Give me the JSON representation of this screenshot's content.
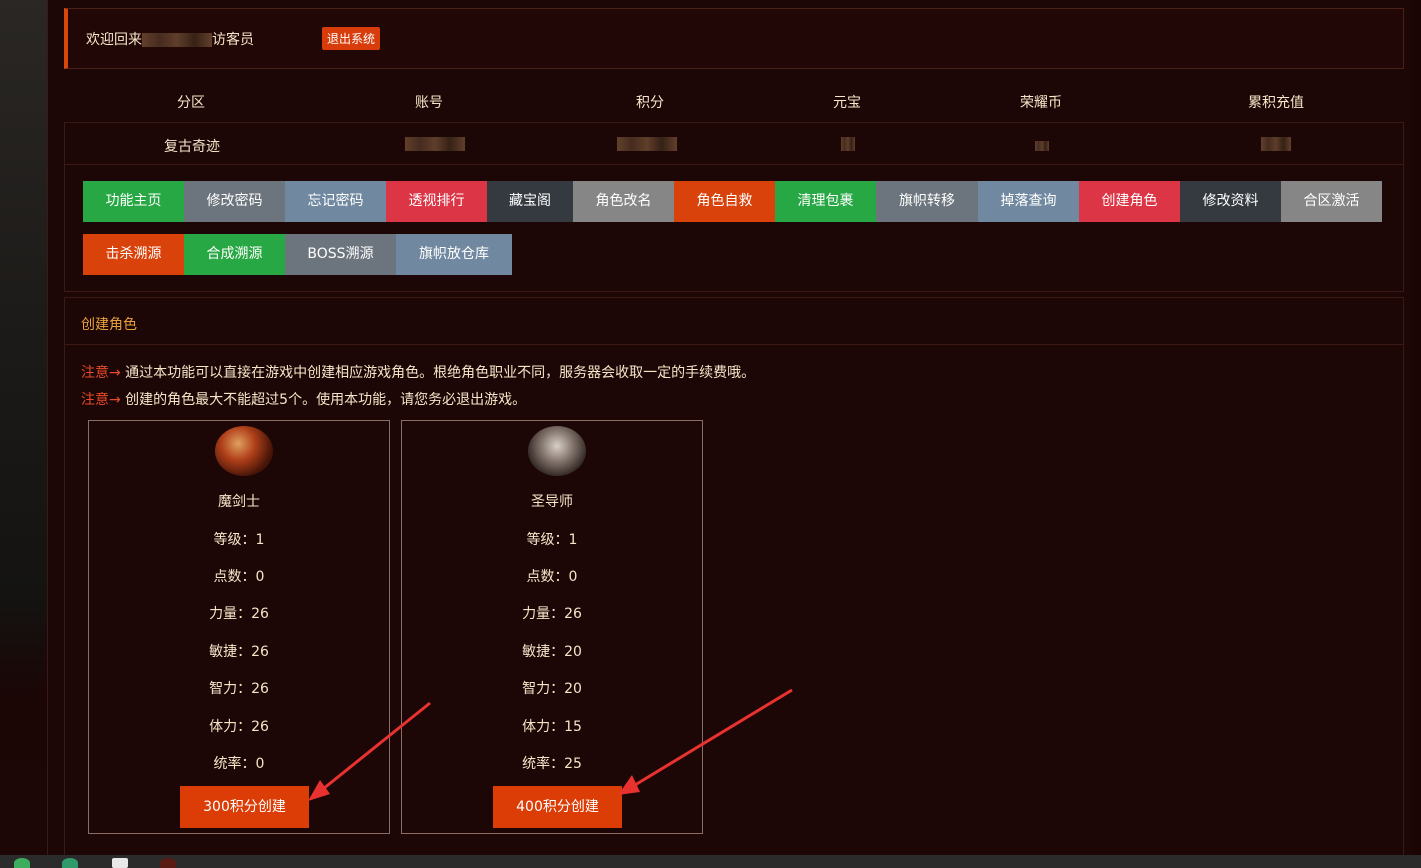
{
  "welcome": {
    "text_prefix": "欢迎回来",
    "text_suffix": "访客员",
    "logout_label": "退出系统"
  },
  "account": {
    "headers": [
      "分区",
      "账号",
      "积分",
      "元宝",
      "荣耀币",
      "累积充值"
    ],
    "zone": "复古奇迹"
  },
  "nav": {
    "row1": [
      {
        "label": "功能主页",
        "color": "#27a844"
      },
      {
        "label": "修改密码",
        "color": "#6c757d"
      },
      {
        "label": "忘记密码",
        "color": "#7089a0"
      },
      {
        "label": "透视排行",
        "color": "#dc3545"
      },
      {
        "label": "藏宝阁",
        "color": "#343a40"
      },
      {
        "label": "角色改名",
        "color": "#868686"
      },
      {
        "label": "角色自救",
        "color": "#d9420a"
      },
      {
        "label": "清理包裹",
        "color": "#27a844"
      },
      {
        "label": "旗帜转移",
        "color": "#6c757d"
      },
      {
        "label": "掉落查询",
        "color": "#7089a0"
      },
      {
        "label": "创建角色",
        "color": "#dc3545"
      },
      {
        "label": "修改资料",
        "color": "#343a40"
      },
      {
        "label": "合区激活",
        "color": "#868686"
      }
    ],
    "row2": [
      {
        "label": "击杀溯源",
        "color": "#d9420a"
      },
      {
        "label": "合成溯源",
        "color": "#27a844"
      },
      {
        "label": "BOSS溯源",
        "color": "#6c757d"
      },
      {
        "label": "旗帜放仓库",
        "color": "#7089a0"
      }
    ]
  },
  "create": {
    "title": "创建角色",
    "notes": [
      {
        "tag": "注意→",
        "text": " 通过本功能可以直接在游戏中创建相应游戏角色。根绝角色职业不同，服务器会收取一定的手续费哦。"
      },
      {
        "tag": "注意→",
        "text": " 创建的角色最大不能超过5个。使用本功能，请您务必退出游戏。"
      }
    ],
    "classes": [
      {
        "name": "魔剑士",
        "stats": [
          "等级：1",
          "点数：0",
          "力量：26",
          "敏捷：26",
          "智力：26",
          "体力：26",
          "统率：0"
        ],
        "button": "300积分创建"
      },
      {
        "name": "圣导师",
        "stats": [
          "等级：1",
          "点数：0",
          "力量：26",
          "敏捷：20",
          "智力：20",
          "体力：15",
          "统率：25"
        ],
        "button": "400积分创建"
      }
    ]
  }
}
